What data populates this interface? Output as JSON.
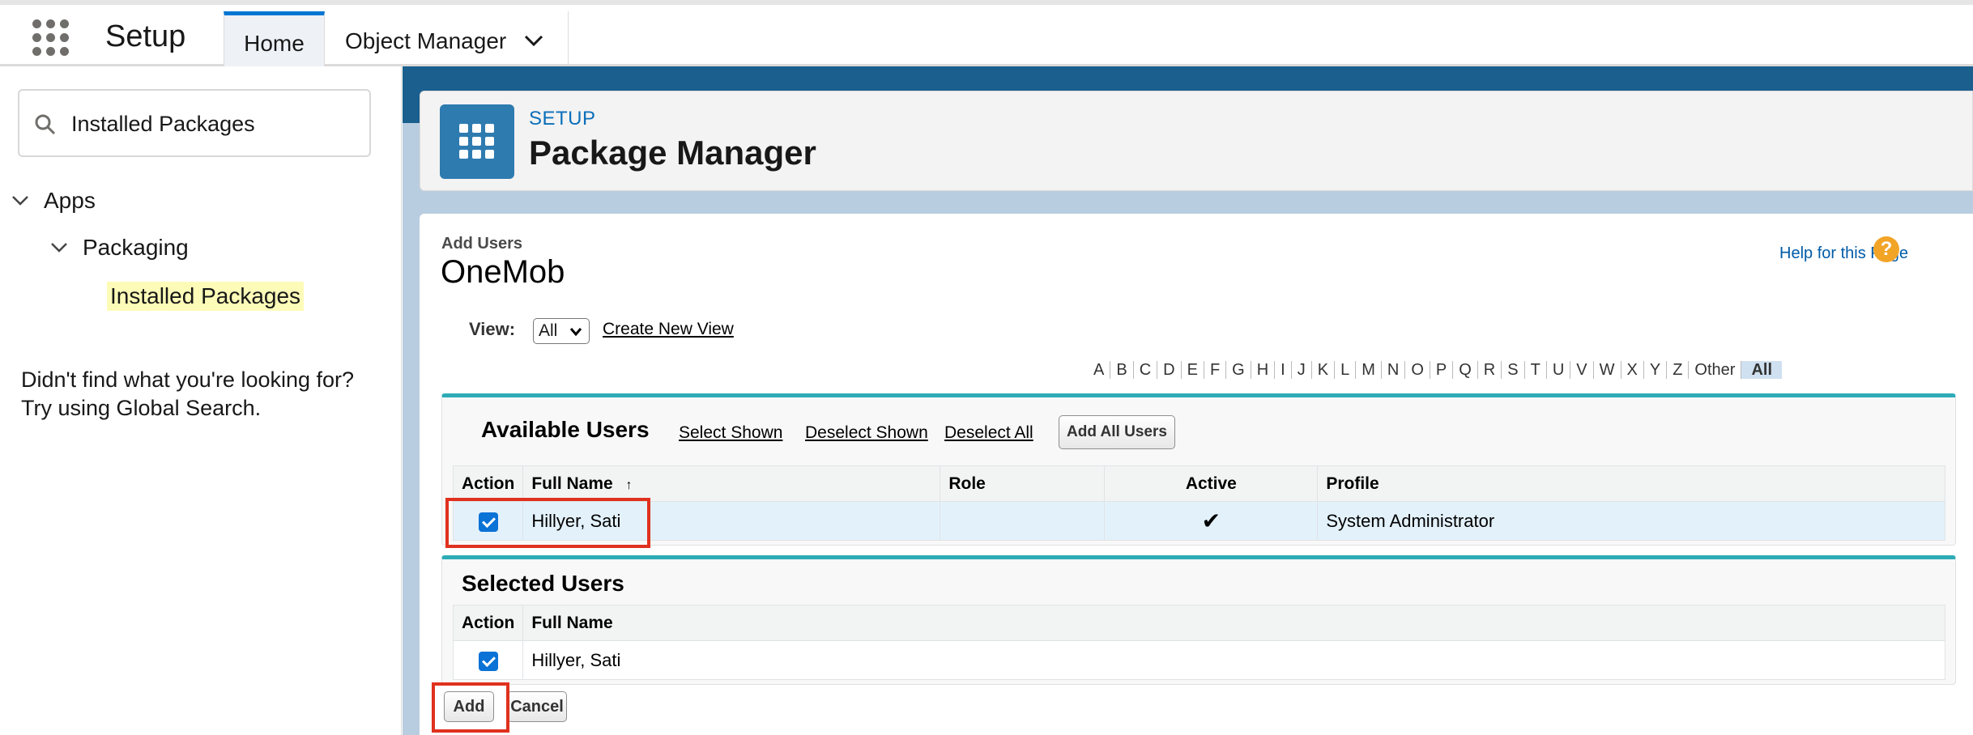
{
  "header": {
    "app_title": "Setup",
    "tabs": [
      {
        "label": "Home"
      },
      {
        "label": "Object Manager"
      }
    ]
  },
  "sidebar": {
    "search_value": "Installed Packages",
    "tree": {
      "apps": "Apps",
      "packaging": "Packaging",
      "installed": "Installed Packages"
    },
    "not_found_line1": "Didn't find what you're looking for?",
    "not_found_line2": "Try using Global Search."
  },
  "page_header": {
    "eyebrow": "SETUP",
    "title": "Package Manager"
  },
  "content": {
    "subtitle": "Add Users",
    "package_name": "OneMob",
    "help_link": "Help for this Page",
    "help_icon": "?",
    "view_label": "View:",
    "view_value": "All",
    "create_new_view": "Create New View",
    "alphabet": [
      "A",
      "B",
      "C",
      "D",
      "E",
      "F",
      "G",
      "H",
      "I",
      "J",
      "K",
      "L",
      "M",
      "N",
      "O",
      "P",
      "Q",
      "R",
      "S",
      "T",
      "U",
      "V",
      "W",
      "X",
      "Y",
      "Z",
      "Other",
      "All"
    ],
    "alphabet_active": "All"
  },
  "available_users": {
    "title": "Available Users",
    "select_shown": "Select Shown",
    "deselect_shown": "Deselect Shown",
    "deselect_all": "Deselect All",
    "add_all_users": "Add All Users",
    "columns": {
      "action": "Action",
      "full_name": "Full Name",
      "sort_arrow": "↑",
      "role": "Role",
      "active": "Active",
      "profile": "Profile"
    },
    "rows": [
      {
        "checked": true,
        "full_name": "Hillyer, Sati",
        "role": "",
        "active": "✔",
        "profile": "System Administrator"
      }
    ]
  },
  "selected_users": {
    "title": "Selected Users",
    "columns": {
      "action": "Action",
      "full_name": "Full Name"
    },
    "rows": [
      {
        "checked": true,
        "full_name": "Hillyer, Sati"
      }
    ]
  },
  "buttons": {
    "add": "Add",
    "cancel": "Cancel"
  },
  "colors": {
    "accent": "#0176d3",
    "panel_border": "#2dacb7",
    "highlight_box": "#e0311f",
    "checkbox": "#0b72d6"
  }
}
